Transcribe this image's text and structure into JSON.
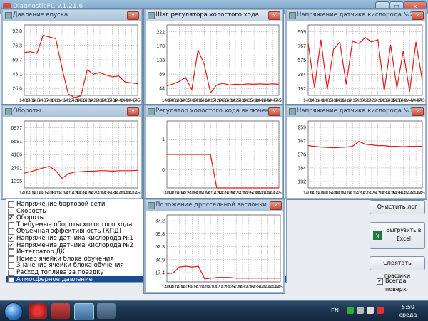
{
  "app": {
    "title": "DiagnosticPC v.1.21.6"
  },
  "windows": [
    {
      "id": "w1",
      "title": "Давление впуска",
      "active": false,
      "chart_data": {
        "type": "line",
        "title": "Давление впуска",
        "yticks": [
          92.8,
          76.3,
          59.7,
          43.1,
          26.6
        ],
        "ylim": [
          18.5,
          100
        ],
        "xticks": [
          "1400",
          "1401",
          "1404",
          "1405",
          "1408",
          "1411",
          "1414",
          "1417",
          "1420",
          "1423",
          "1426",
          "1429",
          "1432",
          "1435",
          "1438",
          "1441",
          "1444",
          "1447",
          "1450"
        ],
        "series": [
          {
            "values": [
              68,
              69,
              67,
              88,
              86,
              84,
              50,
              20,
              16,
              18,
              48,
              43,
              45,
              42,
              40,
              41,
              34,
              33,
              32
            ]
          }
        ]
      }
    },
    {
      "id": "w2",
      "title": "Шаг регулятора холостого хода",
      "active": true,
      "chart_data": {
        "type": "line",
        "title": "Шаг регулятора холостого хода",
        "yticks": [
          222,
          178,
          133,
          89,
          44
        ],
        "ylim": [
          22,
          244
        ],
        "xticks": [
          "1400",
          "1401",
          "1404",
          "1405",
          "1408",
          "1411",
          "1414",
          "1417",
          "1420",
          "1423",
          "1426",
          "1429",
          "1432",
          "1435",
          "1438",
          "1441",
          "1444",
          "1447",
          "1450"
        ],
        "series": [
          {
            "values": [
              52,
              58,
              66,
              78,
              40,
              165,
              120,
              30,
              55,
              60,
              55,
              57,
              56,
              58,
              57,
              58,
              57,
              58,
              57
            ]
          }
        ]
      }
    },
    {
      "id": "w3",
      "title": "Напряжение датчика кислорода №2",
      "active": false,
      "chart_data": {
        "type": "line",
        "title": "Напряжение датчика кислорода №2",
        "yticks": [
          959,
          767,
          575,
          384,
          192
        ],
        "ylim": [
          100,
          1050
        ],
        "xticks": [
          "1400",
          "1401",
          "1404",
          "1405",
          "1408",
          "1411",
          "1414",
          "1417",
          "1420",
          "1423",
          "1426",
          "1429",
          "1432",
          "1435",
          "1438",
          "1441",
          "1444",
          "1447",
          "1450"
        ],
        "series": [
          {
            "values": [
              800,
              200,
              850,
              180,
              720,
              820,
              250,
              830,
              800,
              880,
              820,
              850,
              160,
              780,
              200,
              700,
              150,
              820,
              300
            ]
          }
        ]
      }
    },
    {
      "id": "w4",
      "title": "Обороты",
      "active": false,
      "chart_data": {
        "type": "line",
        "title": "Обороты",
        "yticks": [
          6977,
          5581,
          4186,
          2791,
          1395
        ],
        "ylim": [
          700,
          7700
        ],
        "xticks": [
          "1400",
          "1401",
          "1404",
          "1405",
          "1408",
          "1411",
          "1414",
          "1417",
          "1420",
          "1423",
          "1426",
          "1429",
          "1432",
          "1435",
          "1438",
          "1441",
          "1444",
          "1447",
          "1450"
        ],
        "series": [
          {
            "values": [
              2250,
              2400,
              2600,
              2800,
              2950,
              2500,
              1700,
              2200,
              2350,
              2400,
              2450,
              2450,
              2500,
              2500,
              2450,
              2500,
              2500,
              2500,
              2550
            ]
          }
        ]
      }
    },
    {
      "id": "w5",
      "title": "Регулятор холостого хода включен",
      "active": false,
      "chart_data": {
        "type": "line",
        "title": "Регулятор холостого хода включен",
        "yticks": [
          1,
          0
        ],
        "ylim": [
          -0.6,
          1.6
        ],
        "xticks": [
          "1400",
          "1401",
          "1404",
          "1405",
          "1408",
          "1411",
          "1414",
          "1417",
          "1420",
          "1423",
          "1426",
          "1429",
          "1432",
          "1435",
          "1438",
          "1441",
          "1444",
          "1447",
          "1450"
        ],
        "series": [
          {
            "values": [
              0.5,
              0.5,
              0.5,
              0.5,
              0.5,
              0.5,
              0.5,
              0.5,
              -0.6,
              -0.6,
              -0.6,
              -0.6,
              -0.6,
              -0.6,
              -0.6,
              -0.6,
              -0.6,
              -0.6,
              -0.6
            ]
          }
        ]
      }
    },
    {
      "id": "w6",
      "title": "Напряжение датчика кислорода №1",
      "active": false,
      "chart_data": {
        "type": "line",
        "title": "Напряжение датчика кислорода №1",
        "yticks": [
          959,
          767,
          576,
          384,
          192
        ],
        "ylim": [
          100,
          1050
        ],
        "xticks": [
          "1400",
          "1401",
          "1404",
          "1405",
          "1408",
          "1411",
          "1414",
          "1417",
          "1420",
          "1423",
          "1426",
          "1429",
          "1432",
          "1435",
          "1438",
          "1441",
          "1444",
          "1447",
          "1450"
        ],
        "series": [
          {
            "values": [
              700,
              690,
              680,
              675,
              670,
              675,
              680,
              690,
              760,
              720,
              710,
              700,
              700,
              690,
              690,
              685,
              690,
              690,
              690
            ]
          }
        ]
      }
    },
    {
      "id": "w7",
      "title": "Положение дроссельной заслонки",
      "active": false,
      "chart_data": {
        "type": "line",
        "title": "Положение дроссельной заслонки",
        "yticks": [
          87.2,
          69.8,
          52.3,
          34.9,
          17.4
        ],
        "ylim": [
          5,
          95
        ],
        "xticks": [
          "1400",
          "1401",
          "1404",
          "1405",
          "1408",
          "1411",
          "1414",
          "1417",
          "1420",
          "1423",
          "1426",
          "1429",
          "1432",
          "1435",
          "1438",
          "1441",
          "1444",
          "1447",
          "1450"
        ],
        "series": [
          {
            "values": [
              16,
              17,
              25,
              26,
              25,
              26,
              9,
              10,
              11,
              11,
              11,
              10,
              10,
              10,
              10,
              10,
              10,
              10,
              10
            ]
          }
        ]
      }
    }
  ],
  "params": [
    {
      "label": "Напряжение бортовой сети",
      "checked": false,
      "selected": false
    },
    {
      "label": "Скорость",
      "checked": false,
      "selected": false
    },
    {
      "label": "Обороты",
      "checked": true,
      "selected": false
    },
    {
      "label": "Требуемые обороты холостого хода",
      "checked": false,
      "selected": false
    },
    {
      "label": "Объемная эффективность (КПД)",
      "checked": false,
      "selected": false
    },
    {
      "label": "Напряжение датчика кислорода №1",
      "checked": true,
      "selected": false
    },
    {
      "label": "Напряжение датчика кислорода №2",
      "checked": true,
      "selected": false
    },
    {
      "label": "Интегратор ДК",
      "checked": false,
      "selected": false
    },
    {
      "label": "Номер ячейки блока обучения",
      "checked": false,
      "selected": false
    },
    {
      "label": "Значение ячейки блока обучения",
      "checked": false,
      "selected": false
    },
    {
      "label": "Расход топлива за поездку",
      "checked": false,
      "selected": false
    },
    {
      "label": "Атмосферное давление",
      "checked": false,
      "selected": true
    }
  ],
  "buttons": {
    "clear": "Очистить лог",
    "export": "Выгрузить в Excel",
    "hide": "Спрятать графики"
  },
  "always_on_top": {
    "label": "Всегда поверх",
    "checked": true
  },
  "taskbar": {
    "lang": "EN",
    "time": "5:50",
    "day": "среда"
  },
  "colors": {
    "line": "#e0191b",
    "grid": "#9a9a9a",
    "selected": "#1b4d8c"
  }
}
